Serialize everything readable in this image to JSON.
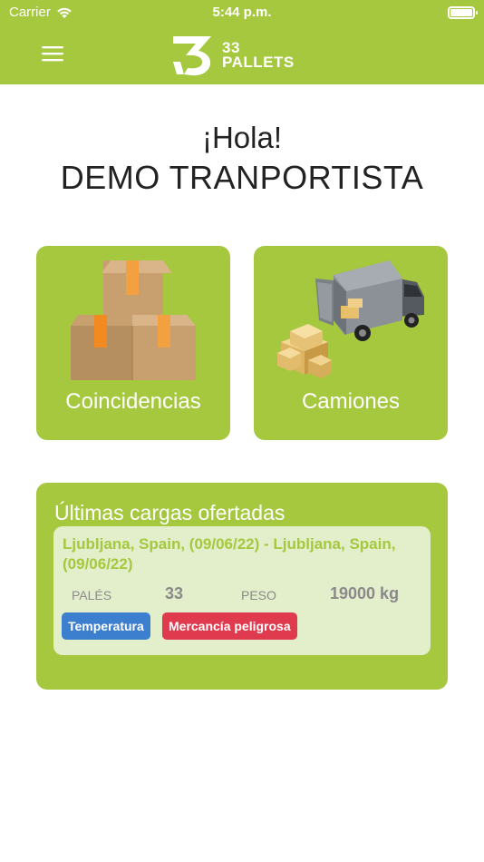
{
  "status_bar": {
    "carrier": "Carrier",
    "time": "5:44 p.m."
  },
  "nav": {
    "logo_text_line1": "33",
    "logo_text_line2": "PALLETS",
    "menu_icon": "hamburger-menu-icon"
  },
  "greeting": {
    "hello": "¡Hola!",
    "user_name": "DEMO TRANPORTISTA"
  },
  "tiles": [
    {
      "label": "Coincidencias",
      "icon": "boxes-icon"
    },
    {
      "label": "Camiones",
      "icon": "truck-icon"
    }
  ],
  "offers": {
    "title": "Últimas cargas ofertadas",
    "items": [
      {
        "route": "Ljubljana, Spain, (09/06/22) - Ljubljana, Spain, (09/06/22)",
        "pallets_label": "PALÉS",
        "pallets_value": "33",
        "weight_label": "PESO",
        "weight_value": "19000 kg",
        "tags": [
          {
            "label": "Temperatura",
            "color": "#3b7fce"
          },
          {
            "label": "Mercancía peligrosa",
            "color": "#e03a4e"
          }
        ]
      }
    ]
  },
  "colors": {
    "brand_green": "#a6c83f",
    "card_light": "#e3eecb"
  }
}
